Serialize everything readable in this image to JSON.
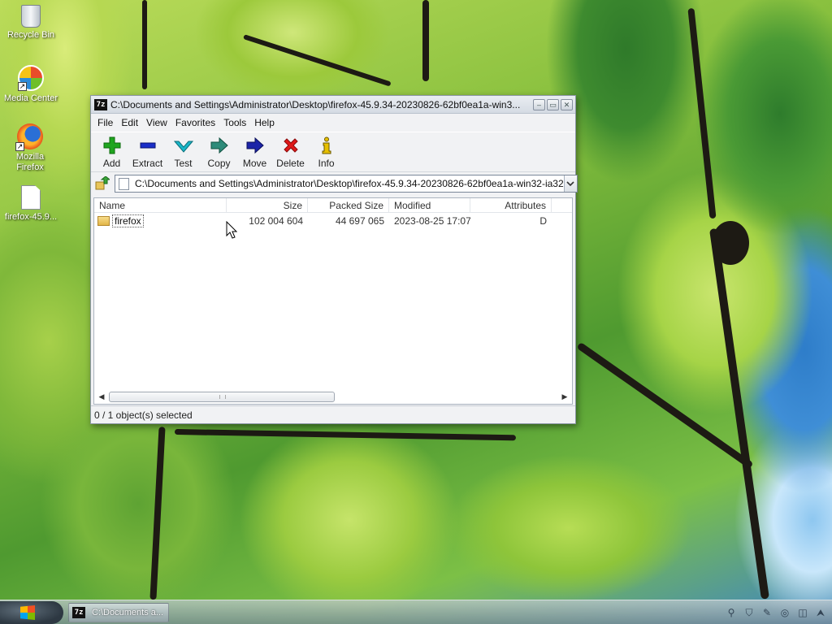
{
  "desktop": {
    "icons": [
      {
        "label": "Recycle Bin"
      },
      {
        "label": "Media Center"
      },
      {
        "label": "Mozilla Firefox"
      },
      {
        "label": "firefox-45.9..."
      }
    ]
  },
  "window": {
    "title": "C:\\Documents and Settings\\Administrator\\Desktop\\firefox-45.9.34-20230826-62bf0ea1a-win3...",
    "app_icon_text": "7z",
    "controls": {
      "minimize": "‒",
      "maximize": "▭",
      "close": "✕"
    },
    "menu": [
      "File",
      "Edit",
      "View",
      "Favorites",
      "Tools",
      "Help"
    ],
    "toolbar": [
      "Add",
      "Extract",
      "Test",
      "Copy",
      "Move",
      "Delete",
      "Info"
    ],
    "address": "C:\\Documents and Settings\\Administrator\\Desktop\\firefox-45.9.34-20230826-62bf0ea1a-win32-ia32",
    "columns": {
      "name": "Name",
      "size": "Size",
      "packed": "Packed Size",
      "modified": "Modified",
      "attributes": "Attributes"
    },
    "rows": [
      {
        "name": "firefox",
        "size": "102 004 604",
        "packed": "44 697 065",
        "modified": "2023-08-25 17:07",
        "attributes": "D"
      }
    ],
    "status": "0 / 1 object(s) selected"
  },
  "taskbar": {
    "task_label": "C:\\Documents a..."
  },
  "colors": {
    "add": "#1fa51f",
    "extract": "#1a2ec8",
    "test": "#19b6c8",
    "copy": "#2e8b7a",
    "move": "#1c24a8",
    "delete": "#e01919",
    "info": "#e7c000"
  }
}
